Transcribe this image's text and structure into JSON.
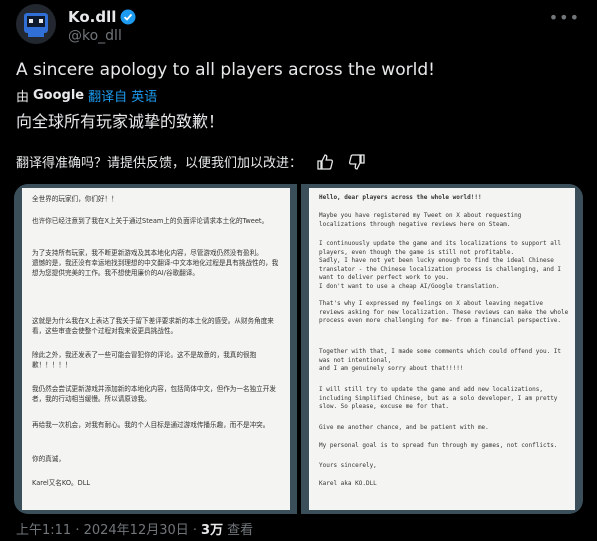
{
  "author": {
    "name": "Ko.dll",
    "handle": "@ko_dll"
  },
  "tweet": {
    "text": "A sincere apology to all players across the world!",
    "translated_by_prefix": "由",
    "translated_by_brand": "Google",
    "translated_from": "翻译自 英语",
    "translation": "向全球所有玩家诚挚的致歉！",
    "feedback_prompt": "翻译得准确吗？请提供反馈，以便我们加以改进："
  },
  "image_left": {
    "paragraphs": [
      "全世界的玩家们，你们好！！",
      "也许你已经注意到了我在X上关于通过Steam上的负面评论请求本土化的Tweet。",
      "为了支持所有玩家，我不断更新游戏及其本地化内容，尽管游戏仍然没有盈利。\n遗憾的是，我还没有幸运地找到理想的中文翻译-中文本地化过程是具有挑战性的，我想为您提供完美的工作。我不想使用廉价的AI/谷歌翻译。",
      "这就是为什么我在X上表达了我关于留下差评要求新的本土化的感受。从财务角度来看，这些审查会使整个过程对我来说更具挑战性。",
      "除此之外，我还发表了一些可能会冒犯你的评论。这不是故意的，我真的很抱歉！！！！！",
      "我仍然会尝试更新游戏并添加新的本地化内容，包括简体中文，但作为一名独立开发者，我的行动相当缓慢。所以请原谅我。",
      "再给我一次机会，对我有耐心。我的个人目标是通过游戏传播乐趣，而不是冲突。",
      "你的真诚，",
      "Karel又名KO。DLL"
    ]
  },
  "image_right": {
    "paragraphs": [
      "Hello, dear players across the whole world!!!",
      "Maybe you have registered my Tweet on X about requesting localizations through negative reviews here on Steam.",
      "I continuously update the game and its localizations to support all players, even though the game is still not profitable.\nSadly, I have not yet been lucky enough to find the ideal Chinese translator - the Chinese localization process is challenging, and I want to deliver perfect work to you.\nI don't want to use a cheap AI/Google translation.",
      "That's why I expressed my feelings on X about leaving negative reviews asking for new localization. These reviews can make the whole process even more challenging for me- from a financial perspective.",
      "Together with that, I made some comments which could offend you. It was not intentional,\nand I am genuinely sorry about that!!!!!",
      "I will still try to update the game and add new localizations, including Simplified Chinese, but as a solo developer, I am pretty slow. So please, excuse me for that.",
      "Give me another chance, and be patient with me.",
      "My personal goal is to spread fun through my games, not conflicts.",
      "Yours sincerely,",
      "Karel aka KO.DLL"
    ]
  },
  "footer": {
    "timestamp": "上午1:11 · 2024年12月30日 ·",
    "views_count": "3万",
    "views_label": "查看"
  },
  "colors": {
    "accent": "#1d9bf0",
    "muted": "#71767b",
    "text": "#e7e9ea",
    "background": "#000000"
  }
}
